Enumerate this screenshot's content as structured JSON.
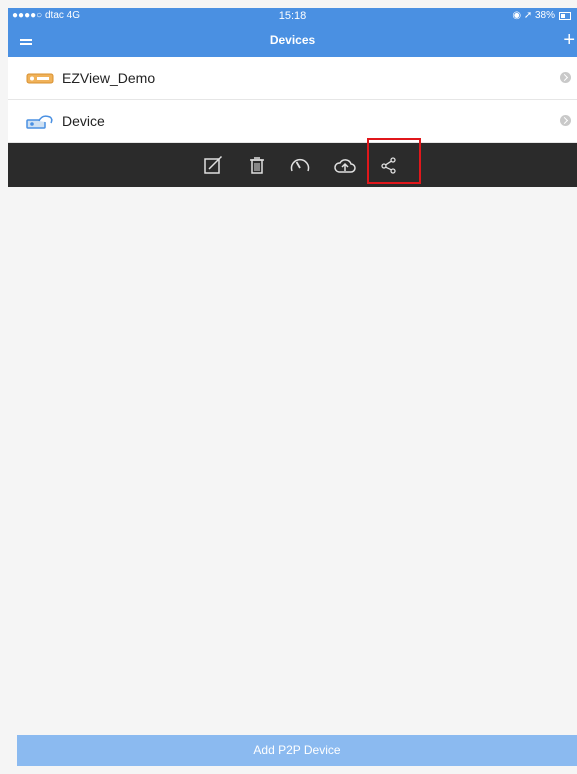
{
  "status_bar": {
    "carrier": "●●●●○ dtac  4G",
    "time": "15:18",
    "right_icons": "◉ ➚ 38%"
  },
  "nav": {
    "title": "Devices",
    "add_icon": "+",
    "menu_icon": "menu-icon"
  },
  "devices": [
    {
      "name": "EZView_Demo",
      "icon": "dvr-icon"
    },
    {
      "name": "Device",
      "icon": "camera-icon"
    }
  ],
  "toolbar": {
    "items": [
      {
        "name": "edit",
        "icon": "edit-icon"
      },
      {
        "name": "delete",
        "icon": "trash-icon"
      },
      {
        "name": "speed",
        "icon": "speedometer-icon"
      },
      {
        "name": "upload",
        "icon": "cloud-upload-icon"
      },
      {
        "name": "share",
        "icon": "share-icon"
      }
    ]
  },
  "footer": {
    "add_button_label": "Add P2P Device"
  },
  "colors": {
    "header": "#4a90e2",
    "toolbar": "#2b2b2b",
    "highlight": "#e0171b",
    "add_button": "#8bbaf0"
  }
}
